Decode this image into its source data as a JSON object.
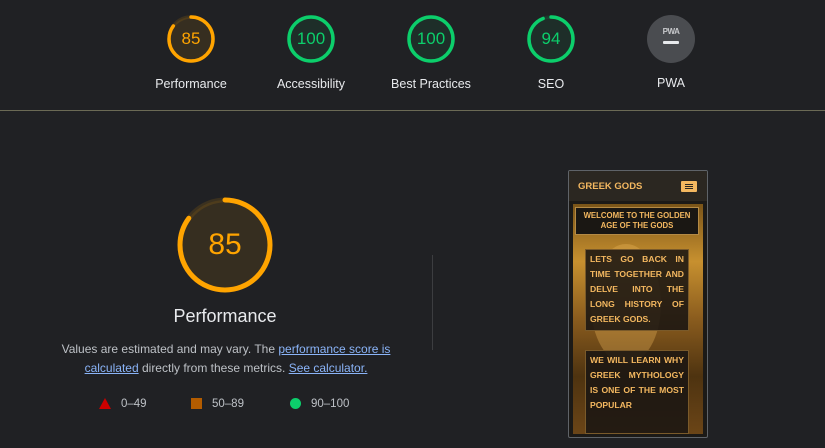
{
  "summary_gauges": [
    {
      "score": "85",
      "label": "Performance",
      "color": "#ffa400",
      "fraction": 0.85
    },
    {
      "score": "100",
      "label": "Accessibility",
      "color": "#0cce6b",
      "fraction": 1.0
    },
    {
      "score": "100",
      "label": "Best Practices",
      "color": "#0cce6b",
      "fraction": 1.0
    },
    {
      "score": "94",
      "label": "SEO",
      "color": "#0cce6b",
      "fraction": 0.94
    },
    {
      "score": "",
      "label": "PWA",
      "badge": "PWA"
    }
  ],
  "performance": {
    "score": "85",
    "fraction": 0.85,
    "color": "#ffa400",
    "title": "Performance",
    "desc_prefix": "Values are estimated and may vary. The ",
    "desc_link": "performance score is calculated",
    "desc_mid": " directly from these metrics. ",
    "desc_link2": "See calculator."
  },
  "legend": [
    {
      "icon": "triangle-icon",
      "range": "0–49",
      "color": "#cc0000"
    },
    {
      "icon": "square-icon",
      "range": "50–89",
      "color": "#b35c00"
    },
    {
      "icon": "circle-icon",
      "range": "90–100",
      "color": "#0cce6b"
    }
  ],
  "screenshot": {
    "brand": "GREEK GODS",
    "hero_title": "WELCOME TO THE GOLDEN AGE OF THE GODS",
    "para1": "LETS GO BACK IN TIME TOGETHER AND DELVE INTO THE LONG HISTORY OF GREEK GODS.",
    "para2": "WE WILL LEARN WHY GREEK MYTHOLOGY IS ONE OF THE MOST POPULAR"
  }
}
